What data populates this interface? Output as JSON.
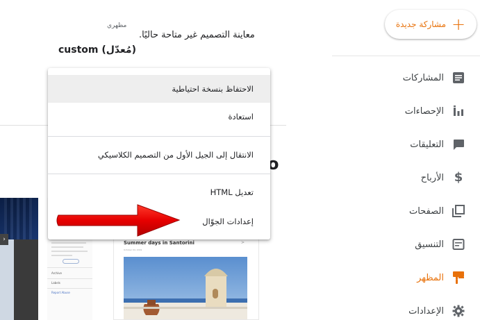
{
  "sidebar": {
    "new_post_label": "مشاركة جديدة",
    "items": [
      {
        "label": "المشاركات",
        "icon": "posts-icon",
        "active": false
      },
      {
        "label": "الإحصاءات",
        "icon": "stats-icon",
        "active": false
      },
      {
        "label": "التعليقات",
        "icon": "comments-icon",
        "active": false
      },
      {
        "label": "الأرباح",
        "icon": "earnings-icon",
        "active": false
      },
      {
        "label": "الصفحات",
        "icon": "pages-icon",
        "active": false
      },
      {
        "label": "التنسيق",
        "icon": "layout-icon",
        "active": false
      },
      {
        "label": "المظهر",
        "icon": "theme-icon",
        "active": true
      },
      {
        "label": "الإعدادات",
        "icon": "settings-icon",
        "active": false
      }
    ]
  },
  "header": {
    "status_text": "معاينة التصميم غير متاحة حاليًا.",
    "theme_label": "مظهري",
    "theme_name": "custom (مُعدّل)"
  },
  "partial_heading": "o",
  "menu": {
    "items": [
      {
        "label": "الاحتفاظ بنسخة احتياطية"
      },
      {
        "label": "استعادة"
      },
      {
        "label": "الانتقال إلى الجيل الأول من التصميم الكلاسيكي"
      },
      {
        "label": "تعديل HTML"
      },
      {
        "label": "إعدادات الجوّال"
      }
    ]
  },
  "preview": {
    "post_title": "Summer days in Santorini",
    "post_date": "October 04, 2019",
    "sidebar_labels": [
      "Archive",
      "Labels",
      "Report Abuse"
    ]
  },
  "colors": {
    "accent": "#e8710a",
    "arrow": "#e60000",
    "text": "#202124",
    "icon": "#5f6368"
  }
}
